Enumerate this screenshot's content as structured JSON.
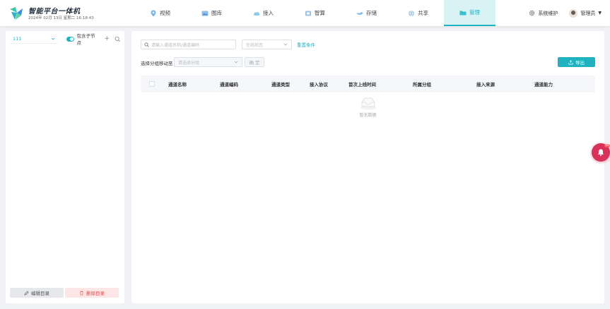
{
  "header": {
    "brand_title": "智能平台一体机",
    "brand_date": "2024年 02月 13日 星期二 16:18:43",
    "nav": [
      {
        "label": "视频",
        "icon": "location-pin-icon"
      },
      {
        "label": "图库",
        "icon": "image-gallery-icon"
      },
      {
        "label": "接入",
        "icon": "cloud-connect-icon"
      },
      {
        "label": "智算",
        "icon": "compute-box-icon"
      },
      {
        "label": "存储",
        "icon": "storage-icon"
      },
      {
        "label": "共享",
        "icon": "share-globe-icon"
      },
      {
        "label": "管理",
        "icon": "folder-manage-icon"
      }
    ],
    "active_nav": "管理",
    "system_label": "系统维护",
    "user_label": "管理员"
  },
  "sidebar": {
    "selector_value": "111",
    "include_children_label": "包含子节点",
    "include_children_on": true,
    "edit_button": "编辑目录",
    "delete_button": "删除目录"
  },
  "main": {
    "search_placeholder": "请输入通道名称/通道编码",
    "status_placeholder": "在线状态",
    "reset_label": "重置条件",
    "move_label": "选择分组移动至",
    "group_placeholder": "请选择分组",
    "confirm_label": "确 定",
    "export_label": "导出",
    "columns": [
      "通道名称",
      "通道编码",
      "通道类型",
      "接入协议",
      "首次上线时间",
      "所属分组",
      "接入来源",
      "通道能力"
    ],
    "empty_text": "暂无数据"
  },
  "notification": {
    "badge": "99"
  },
  "colors": {
    "accent": "#1fb2c0",
    "danger": "#e34d4d",
    "bell": "#d8325a"
  }
}
